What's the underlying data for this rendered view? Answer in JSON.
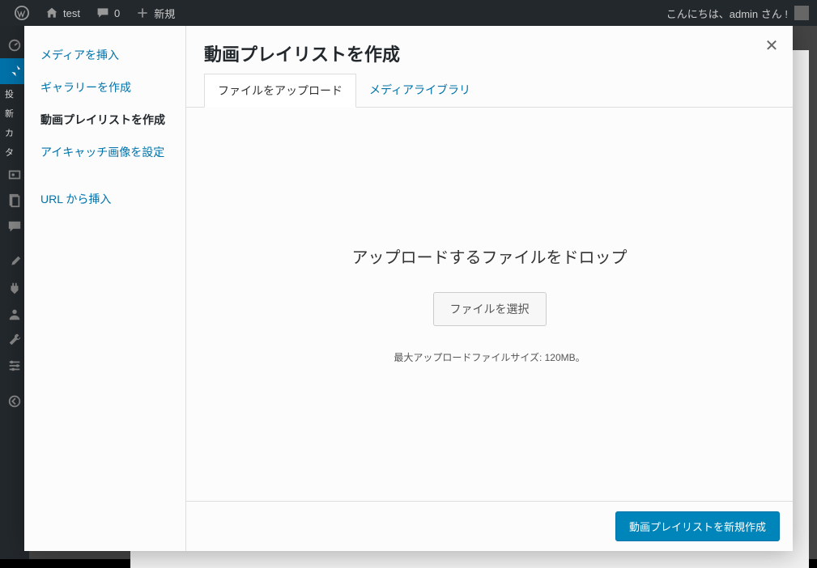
{
  "adminbar": {
    "site_name": "test",
    "comments_count": "0",
    "new_label": "新規",
    "greeting": "こんにちは、admin さん !"
  },
  "admin_menu_labels": {
    "posts": "投",
    "new": "新",
    "categories": "カ",
    "tags": "タ"
  },
  "modal": {
    "close_label": "✕",
    "side": {
      "insert_media": "メディアを挿入",
      "create_gallery": "ギャラリーを作成",
      "create_video_playlist": "動画プレイリストを作成",
      "set_featured": "アイキャッチ画像を設定",
      "insert_from_url": "URL から挿入"
    },
    "title": "動画プレイリストを作成",
    "tabs": {
      "upload": "ファイルをアップロード",
      "library": "メディアライブラリ"
    },
    "upload": {
      "drop_text": "アップロードするファイルをドロップ",
      "select_files": "ファイルを選択",
      "max_size": "最大アップロードファイルサイズ: 120MB。"
    },
    "footer": {
      "create_button": "動画プレイリストを新規作成"
    }
  }
}
